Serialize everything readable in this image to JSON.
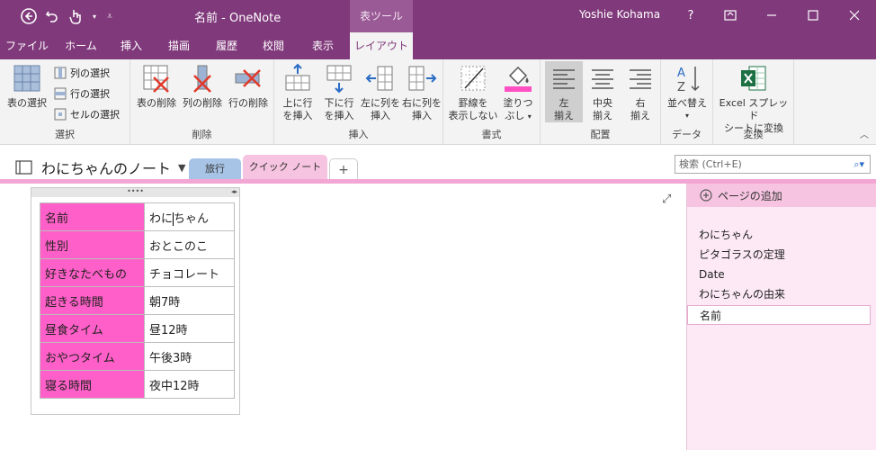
{
  "titlebar": {
    "title": "名前 - OneNote",
    "tool_tab": "表ツール",
    "user": "Yoshie Kohama",
    "help": "?"
  },
  "tabs": [
    "ファイル",
    "ホーム",
    "挿入",
    "描画",
    "履歴",
    "校閲",
    "表示",
    "レイアウト"
  ],
  "active_tab": "レイアウト",
  "ribbon": {
    "select": {
      "label": "選択",
      "table_select": "表の選択",
      "col_select": "列の選択",
      "row_select": "行の選択",
      "cell_select": "セルの選択"
    },
    "delete": {
      "label": "削除",
      "table_delete": "表の削除",
      "col_delete": "列の削除",
      "row_delete": "行の削除"
    },
    "insert": {
      "label": "挿入",
      "above_1": "上に行",
      "above_2": "を挿入",
      "below_1": "下に行",
      "below_2": "を挿入",
      "left_1": "左に列を",
      "left_2": "挿入",
      "right_1": "右に列を",
      "right_2": "挿入"
    },
    "format": {
      "label": "書式",
      "borders_1": "罫線を",
      "borders_2": "表示しない",
      "shading_1": "塗りつ",
      "shading_2": "ぶし"
    },
    "align": {
      "label": "配置",
      "left_1": "左",
      "left_2": "揃え",
      "center_1": "中央",
      "center_2": "揃え",
      "right_1": "右",
      "right_2": "揃え"
    },
    "data": {
      "label": "データ",
      "sort": "並べ替え"
    },
    "convert": {
      "label": "変換",
      "excel_1": "Excel スプレッド",
      "excel_2": "シートに変換"
    }
  },
  "notebook": {
    "name": "わにちゃんのノート",
    "sections": [
      "旅行",
      "クイック ノート"
    ],
    "add_section": "+"
  },
  "search": {
    "placeholder": "検索 (Ctrl+E)"
  },
  "table": [
    {
      "key": "名前",
      "value_a": "わに",
      "value_b": "ちゃん"
    },
    {
      "key": "性別",
      "value": "おとこのこ"
    },
    {
      "key": "好きなたべもの",
      "value": "チョコレート"
    },
    {
      "key": "起きる時間",
      "value": "朝7時"
    },
    {
      "key": "昼食タイム",
      "value": "昼12時"
    },
    {
      "key": "おやつタイム",
      "value": "午後3時"
    },
    {
      "key": "寝る時間",
      "value": "夜中12時"
    }
  ],
  "pages_panel": {
    "add_page": "ページの追加",
    "pages": [
      "わにちゃん",
      "ピタゴラスの定理",
      "Date",
      "わにちゃんの由来",
      "名前"
    ],
    "selected": "名前"
  },
  "colors": {
    "brand": "#80397b",
    "table_key_bg": "#ff5fc8",
    "section_travel": "#a7c4e6",
    "section_quick": "#f6c4e0"
  }
}
